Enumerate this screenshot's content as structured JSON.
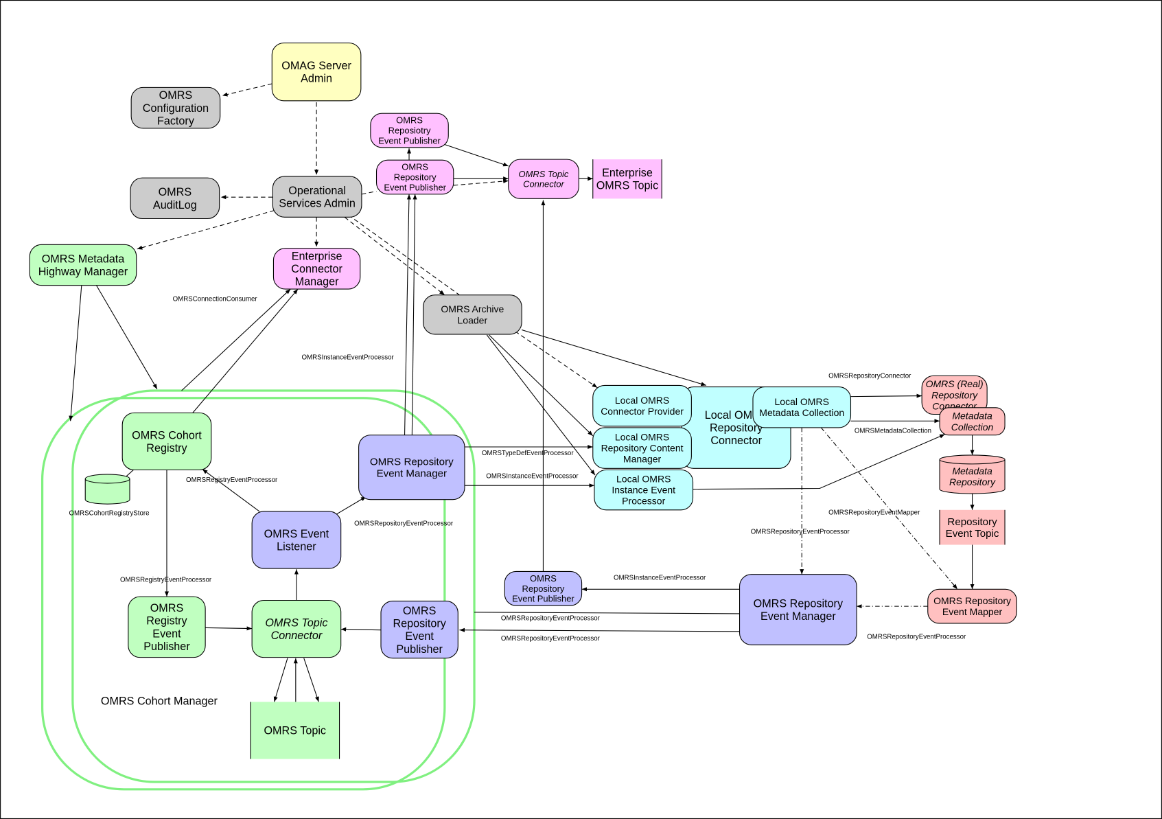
{
  "colors": {
    "yellow": "#ffffc0",
    "gray": "#cccccc",
    "pink": "#ffc0ff",
    "green": "#c0ffc0",
    "cyan": "#c0ffff",
    "purple": "#c0c0ff",
    "red": "#ffc0c0",
    "cohort_outline": "#80f080"
  },
  "nodes": {
    "omag_admin": {
      "lines": [
        "OMAG Server",
        "Admin"
      ]
    },
    "config_factory": {
      "lines": [
        "OMRS",
        "Configuration",
        "Factory"
      ]
    },
    "audit_log": {
      "lines": [
        "OMRS",
        "AuditLog"
      ]
    },
    "op_services_admin": {
      "lines": [
        "Operational",
        "Services Admin"
      ]
    },
    "ent_pub_upper": {
      "lines": [
        "OMRS",
        "Reposiotry",
        "Event Publisher"
      ]
    },
    "ent_pub": {
      "lines": [
        "OMRS",
        "Repository",
        "Event Publisher"
      ]
    },
    "ent_topic_connector": {
      "lines": [
        "OMRS Topic",
        "Connector"
      ]
    },
    "ent_omrs_topic": {
      "lines": [
        "Enterprise",
        "OMRS Topic"
      ]
    },
    "metadata_highway": {
      "lines": [
        "OMRS Metadata",
        "Highway Manager"
      ]
    },
    "ent_connector_mgr": {
      "lines": [
        "Enterprise",
        "Connector",
        "Manager"
      ]
    },
    "archive_loader": {
      "lines": [
        "OMRS Archive",
        "Loader"
      ]
    },
    "local_repo_connector": {
      "lines": [
        "Local OMRS",
        "Repository",
        "Connector"
      ]
    },
    "local_connector_provider": {
      "lines": [
        "Local OMRS",
        "Connector Provider"
      ]
    },
    "local_content_mgr": {
      "lines": [
        "Local OMRS",
        "Repository Content",
        "Manager"
      ]
    },
    "local_instance_proc": {
      "lines": [
        "Local OMRS",
        "Instance Event",
        "Processor"
      ]
    },
    "local_metadata_coll": {
      "lines": [
        "Local OMRS",
        "Metadata Collection"
      ]
    },
    "real_repo_connector": {
      "lines": [
        "OMRS (Real)",
        "Repository",
        "Connector"
      ]
    },
    "metadata_collection": {
      "lines": [
        "Metadata",
        "Collection"
      ]
    },
    "metadata_repository": {
      "lines": [
        "Metadata",
        "Repository"
      ]
    },
    "repo_event_topic": {
      "lines": [
        "Repository",
        "Event Topic"
      ]
    },
    "repo_event_mapper": {
      "lines": [
        "OMRS Repository",
        "Event Mapper"
      ]
    },
    "repo_event_mgr_right": {
      "lines": [
        "OMRS Repository",
        "Event Manager"
      ]
    },
    "small_event_pub": {
      "lines": [
        "OMRS",
        "Repository",
        "Event Publisher"
      ]
    },
    "cohort_registry": {
      "lines": [
        "OMRS Cohort",
        "Registry"
      ]
    },
    "cohort_store": {
      "lines": []
    },
    "repo_event_mgr_left": {
      "lines": [
        "OMRS Repository",
        "Event Manager"
      ]
    },
    "event_listener": {
      "lines": [
        "OMRS Event",
        "Listener"
      ]
    },
    "registry_event_pub": {
      "lines": [
        "OMRS",
        "Registry",
        "Event",
        "Publisher"
      ]
    },
    "cohort_topic_connector": {
      "lines": [
        "OMRS Topic",
        "Connector"
      ]
    },
    "cohort_repo_event_pub": {
      "lines": [
        "OMRS",
        "Repository",
        "Event",
        "Publisher"
      ]
    },
    "omrs_topic": {
      "lines": [
        "OMRS Topic"
      ]
    }
  },
  "cohort_label": "OMRS Cohort Manager",
  "edge_labels": [
    "OMRSConnectionConsumer",
    "OMRSInstanceEventProcessor",
    "OMRSRegistryEventProcessor",
    "OMRSCohortRegistryStore",
    "OMRSRepositoryEventProcessor",
    "OMRSRegistryEventProcessor",
    "OMRSTypeDefEventProcessor",
    "OMRSInstanceEventProcessor",
    "OMRSRepositoryConnector",
    "OMRSMetadataCollection",
    "OMRSRepositoryEventMapper",
    "OMRSRepositoryEventProcessor",
    "OMRSInstanceEventProcessor",
    "OMRSRepositoryEventProcessor",
    "OMRSRepositoryEventProcessor",
    "OMRSRepositoryEventProcessor"
  ]
}
